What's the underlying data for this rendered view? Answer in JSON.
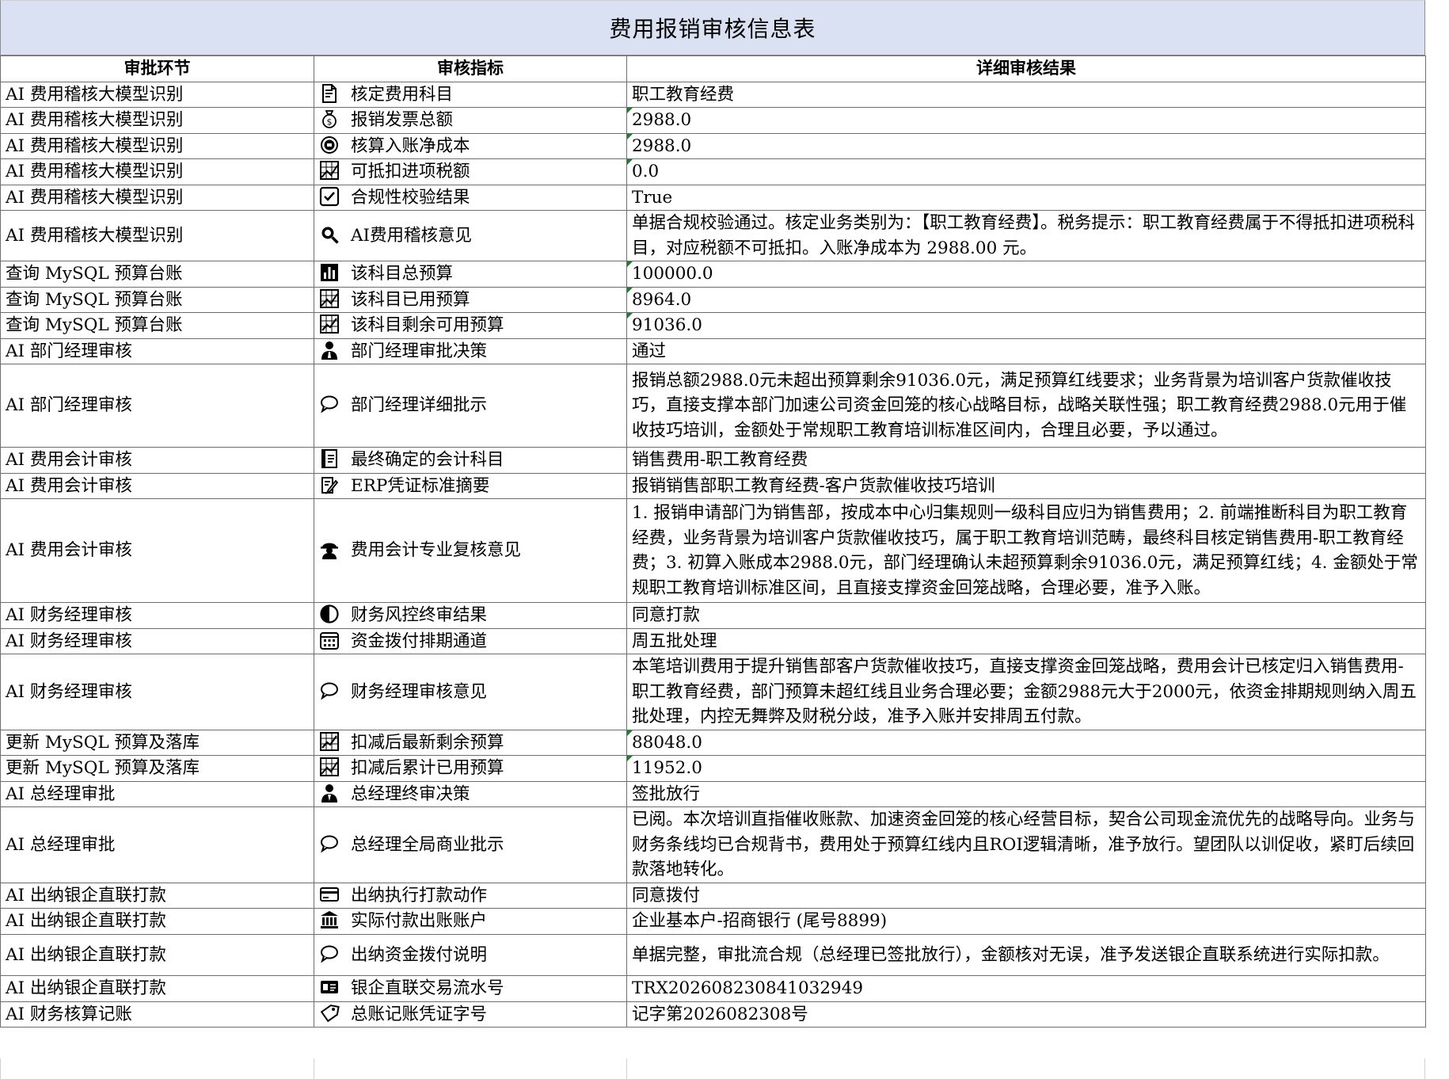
{
  "title": "费用报销审核信息表",
  "headers": [
    "审批环节",
    "审核指标",
    "详细审核结果"
  ],
  "rows": [
    {
      "stage": "AI 费用稽核大模型识别",
      "icon": "document-icon",
      "metric": "核定费用科目",
      "result": "职工教育经费",
      "num": false,
      "lines": 1
    },
    {
      "stage": "AI 费用稽核大模型识别",
      "icon": "money-bag-icon",
      "metric": "报销发票总额",
      "result": "2988.0",
      "num": true,
      "lines": 1
    },
    {
      "stage": "AI 费用稽核大模型识别",
      "icon": "coin-icon",
      "metric": "核算入账净成本",
      "result": "2988.0",
      "num": true,
      "lines": 1
    },
    {
      "stage": "AI 费用稽核大模型识别",
      "icon": "chart-box-icon",
      "metric": "可抵扣进项税额",
      "result": "0.0",
      "num": true,
      "lines": 1
    },
    {
      "stage": "AI 费用稽核大模型识别",
      "icon": "checkbox-icon",
      "metric": "合规性校验结果",
      "result": "True",
      "num": false,
      "lines": 1
    },
    {
      "stage": "AI 费用稽核大模型识别",
      "icon": "magnifier-icon",
      "metric": "AI费用稽核意见",
      "result": "单据合规校验通过。核定业务类别为：【职工教育经费】。税务提示：职工教育经费属于不得抵扣进项税科目，对应税额不可抵扣。入账净成本为 2988.00 元。",
      "num": false,
      "lines": 2
    },
    {
      "stage": "查询 MySQL 预算台账",
      "icon": "bar-chart-icon",
      "metric": "该科目总预算",
      "result": "100000.0",
      "num": true,
      "lines": 1
    },
    {
      "stage": "查询 MySQL 预算台账",
      "icon": "chart-box-icon",
      "metric": "该科目已用预算",
      "result": "8964.0",
      "num": true,
      "lines": 1
    },
    {
      "stage": "查询 MySQL 预算台账",
      "icon": "trend-chart-icon",
      "metric": "该科目剩余可用预算",
      "result": "91036.0",
      "num": true,
      "lines": 1
    },
    {
      "stage": "AI 部门经理审核",
      "icon": "manager-icon",
      "metric": "部门经理审批决策",
      "result": "通过",
      "num": false,
      "lines": 1
    },
    {
      "stage": "AI 部门经理审核",
      "icon": "speech-bubble-icon",
      "metric": "部门经理详细批示",
      "result": "报销总额2988.0元未超出预算剩余91036.0元，满足预算红线要求；业务背景为培训客户货款催收技巧，直接支撑本部门加速公司资金回笼的核心战略目标，战略关联性强；职工教育经费2988.0元用于催收技巧培训，金额处于常规职工教育培训标准区间内，合理且必要，予以通过。",
      "num": false,
      "lines": 4
    },
    {
      "stage": "AI 费用会计审核",
      "icon": "ledger-icon",
      "metric": "最终确定的会计科目",
      "result": "销售费用-职工教育经费",
      "num": false,
      "lines": 1
    },
    {
      "stage": "AI 费用会计审核",
      "icon": "memo-icon",
      "metric": "ERP凭证标准摘要",
      "result": "报销销售部职工教育经费-客户货款催收技巧培训",
      "num": false,
      "lines": 1
    },
    {
      "stage": "AI 费用会计审核",
      "icon": "detective-icon",
      "metric": "费用会计专业复核意见",
      "result": "1. 报销申请部门为销售部，按成本中心归集规则一级科目应归为销售费用；2. 前端推断科目为职工教育经费，业务背景为培训客户货款催收技巧，属于职工教育培训范畴，最终科目核定销售费用-职工教育经费；3. 初算入账成本2988.0元，部门经理确认未超预算剩余91036.0元，满足预算红线；4. 金额处于常规职工教育培训标准区间，且直接支撑资金回笼战略，合理必要，准予入账。",
      "num": false,
      "lines": 5
    },
    {
      "stage": "AI 财务经理审核",
      "icon": "shield-half-icon",
      "metric": "财务风控终审结果",
      "result": "同意打款",
      "num": false,
      "lines": 1
    },
    {
      "stage": "AI 财务经理审核",
      "icon": "calendar-icon",
      "metric": "资金拨付排期通道",
      "result": "周五批处理",
      "num": false,
      "lines": 1
    },
    {
      "stage": "AI 财务经理审核",
      "icon": "speech-bubble-icon",
      "metric": "财务经理审核意见",
      "result": "本笔培训费用于提升销售部客户货款催收技巧，直接支撑资金回笼战略，费用会计已核定归入销售费用-职工教育经费，部门预算未超红线且业务合理必要；金额2988元大于2000元，依资金排期规则纳入周五批处理，内控无舞弊及财税分歧，准予入账并安排周五付款。",
      "num": false,
      "lines": 3
    },
    {
      "stage": "更新 MySQL 预算及落库",
      "icon": "trend-chart-icon",
      "metric": "扣减后最新剩余预算",
      "result": "88048.0",
      "num": true,
      "lines": 1
    },
    {
      "stage": "更新 MySQL 预算及落库",
      "icon": "chart-box-icon",
      "metric": "扣减后累计已用预算",
      "result": "11952.0",
      "num": true,
      "lines": 1
    },
    {
      "stage": "AI 总经理审批",
      "icon": "executive-icon",
      "metric": "总经理终审决策",
      "result": "签批放行",
      "num": false,
      "lines": 1
    },
    {
      "stage": "AI 总经理审批",
      "icon": "speech-bubble-icon",
      "metric": "总经理全局商业批示",
      "result": "已阅。本次培训直指催收账款、加速资金回笼的核心经营目标，契合公司现金流优先的战略导向。业务与财务条线均已合规背书，费用处于预算红线内且ROI逻辑清晰，准予放行。望团队以训促收，紧盯后续回款落地转化。",
      "num": false,
      "lines": 3
    },
    {
      "stage": "AI 出纳银企直联打款",
      "icon": "credit-card-icon",
      "metric": "出纳执行打款动作",
      "result": "同意拨付",
      "num": false,
      "lines": 1
    },
    {
      "stage": "AI 出纳银企直联打款",
      "icon": "bank-icon",
      "metric": "实际付款出账账户",
      "result": "企业基本户-招商银行 (尾号8899)",
      "num": false,
      "lines": 1
    },
    {
      "stage": "AI 出纳银企直联打款",
      "icon": "speech-bubble-icon",
      "metric": "出纳资金拨付说明",
      "result": "单据完整，审批流合规（总经理已签批放行），金额核对无误，准予发送银企直联系统进行实际扣款。",
      "num": false,
      "lines": 2
    },
    {
      "stage": "AI 出纳银企直联打款",
      "icon": "id-card-icon",
      "metric": "银企直联交易流水号",
      "result": "TRX202608230841032949",
      "num": false,
      "lines": 1
    },
    {
      "stage": "AI 财务核算记账",
      "icon": "tag-icon",
      "metric": "总账记账凭证字号",
      "result": "记字第2026082308号",
      "num": false,
      "lines": 1
    }
  ]
}
